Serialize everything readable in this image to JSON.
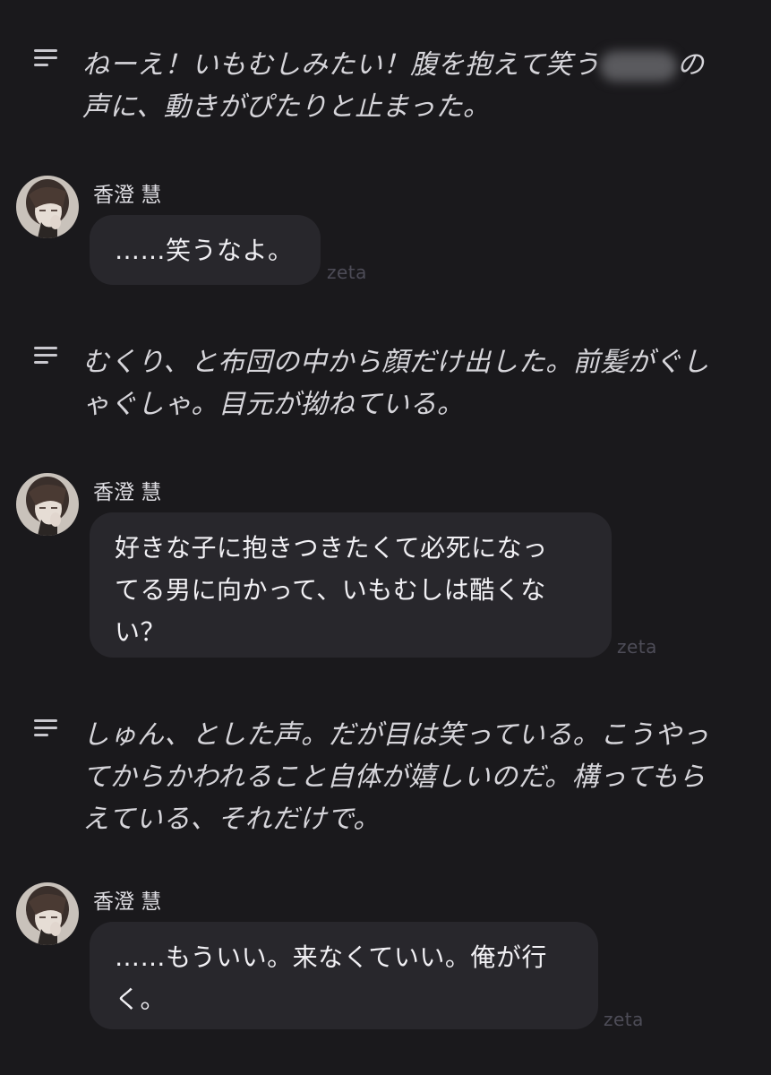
{
  "narrations": [
    {
      "line1_before": "ねーえ！いもむしみたい！腹を抱えて笑う",
      "line1_after": "の",
      "line2": "声に、動きがぴたりと止まった。"
    },
    {
      "text": "むくり、と布団の中から顔だけ出した。前髪がぐし\nゃぐしゃ。目元が拗ねている。"
    },
    {
      "text": "しゅん、とした声。だが目は笑っている。こうやっ\nてからかわれること自体が嬉しいのだ。構ってもら\nえている、それだけで。"
    }
  ],
  "messages": [
    {
      "speaker": "香澄 慧",
      "text": "……笑うなよ。",
      "brand": "zeta"
    },
    {
      "speaker": "香澄 慧",
      "text": "好きな子に抱きつきたくて必死になっ\nてる男に向かって、いもむしは酷くな\nい？",
      "brand": "zeta"
    },
    {
      "speaker": "香澄 慧",
      "text": "……もういい。来なくていい。俺が行\nく。",
      "brand": "zeta"
    }
  ],
  "icons": {
    "narration": "narration-lines-icon",
    "avatar": "character-avatar"
  },
  "colors": {
    "background": "#1a191c",
    "bubble": "#28272c",
    "narration_text": "#d6d5da",
    "brand_text": "#4d4c57"
  }
}
